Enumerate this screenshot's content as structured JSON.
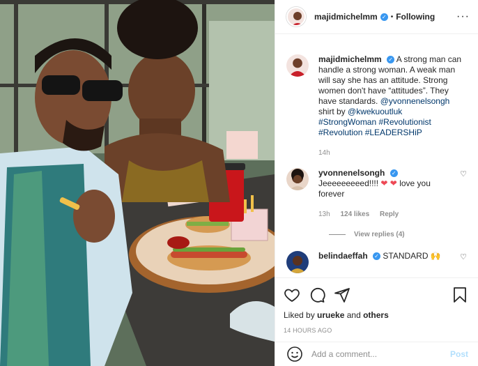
{
  "post": {
    "author": "majidmichelmm",
    "follow_status": "Following",
    "caption_text": "A strong man can handle a strong woman. A weak man will say she has an attitude. Strong women don't have “attitudes”. They have standards.",
    "caption_mention_1": "@yvonnenelsongh",
    "caption_text_2": "shirt by",
    "caption_mention_2": "@kwekuoutluk",
    "hashtags_line_1": "#StrongWoman #Revolutionist",
    "hashtags_line_2": "#Revolution #LEADERSHiP",
    "caption_age": "14h"
  },
  "comments": [
    {
      "user": "yvonnenelsongh",
      "text_before": "Jeeeeeeeeed!!!! ",
      "hearts": "❤ ❤",
      "text_after": " love you forever",
      "age": "13h",
      "likes": "124 likes",
      "reply": "Reply",
      "view_replies": "View replies (4)"
    },
    {
      "user": "belindaeffah",
      "text": "STANDARD 🙌"
    }
  ],
  "footer": {
    "liked_by_prefix": "Liked by ",
    "liked_by_user": "urueke",
    "liked_by_and": " and ",
    "liked_by_others": "others",
    "timestamp": "14 HOURS AGO",
    "comment_placeholder": "Add a comment...",
    "post_label": "Post"
  },
  "icons": {
    "like": "heart-outline-icon",
    "comment": "speech-bubble-icon",
    "share": "paper-plane-icon",
    "save": "bookmark-icon",
    "emoji": "smiley-icon",
    "more": "ellipsis-icon"
  },
  "colors": {
    "verified": "#3897f0",
    "link": "#00376b",
    "muted": "#8e8e8e",
    "heart": "#ed4956",
    "post_disabled": "#b2dffc"
  }
}
